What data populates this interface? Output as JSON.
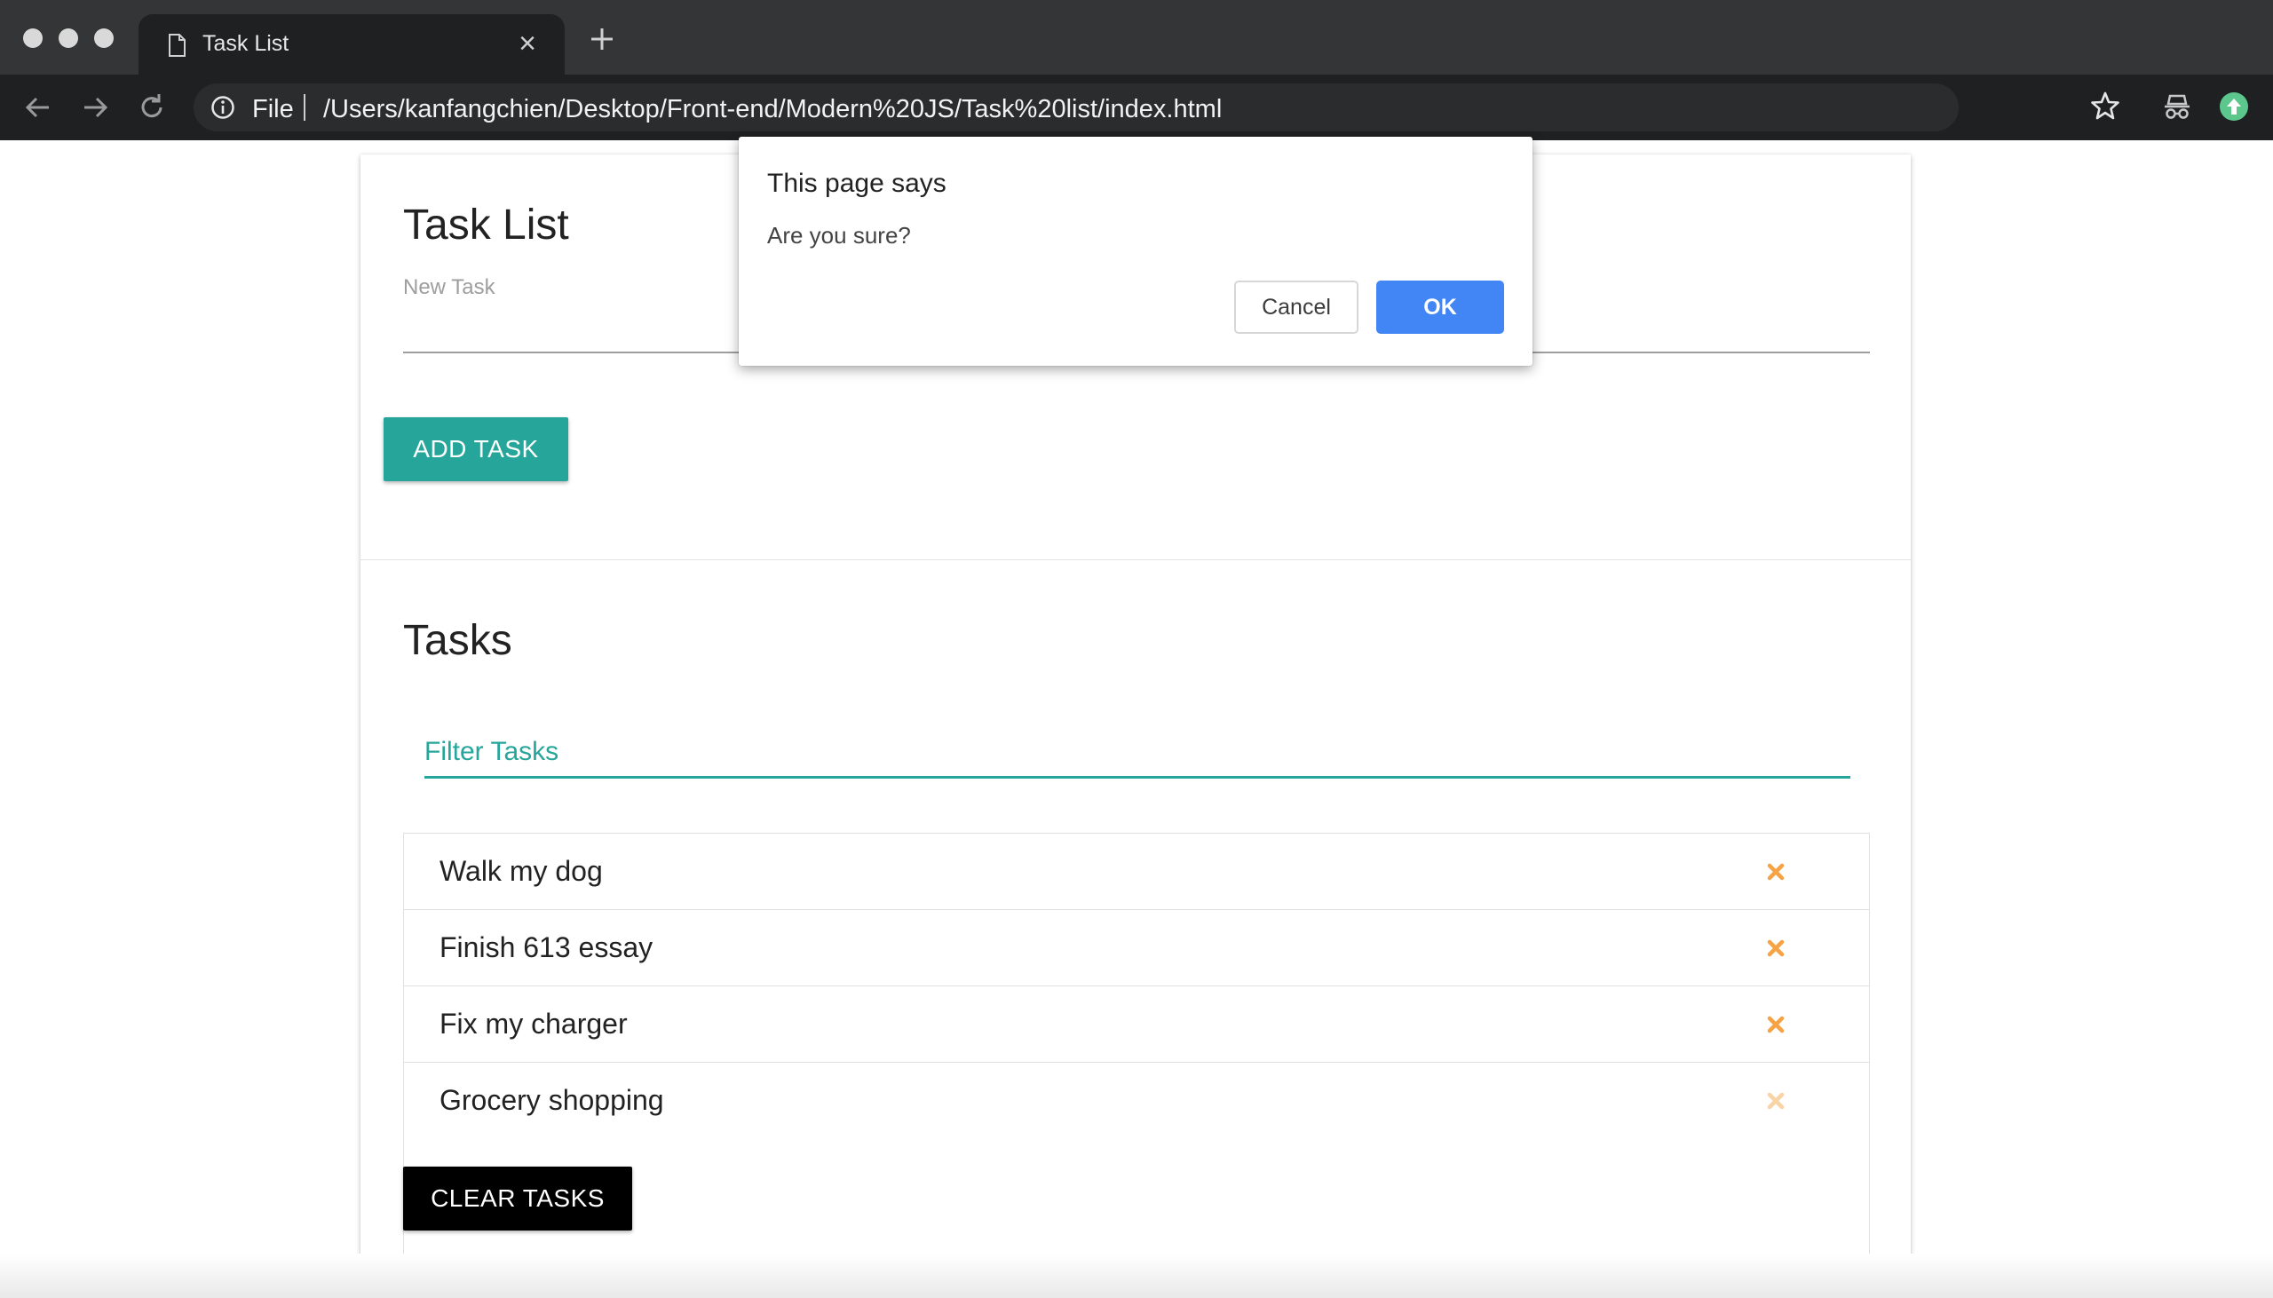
{
  "browser": {
    "tab_title": "Task List",
    "scheme_label": "File",
    "url": "/Users/kanfangchien/Desktop/Front-end/Modern%20JS/Task%20list/index.html",
    "close_glyph": "×"
  },
  "page": {
    "title": "Task List",
    "new_task_label": "New Task",
    "new_task_value": "",
    "add_button": "ADD TASK",
    "tasks_title": "Tasks",
    "filter_placeholder": "Filter Tasks",
    "tasks": [
      {
        "text": "Walk my dog"
      },
      {
        "text": "Finish 613 essay"
      },
      {
        "text": "Fix my charger"
      },
      {
        "text": "Grocery shopping"
      }
    ],
    "clear_button": "CLEAR TASKS",
    "accent_color": "#26a69a",
    "delete_icon_color": "#f6a345"
  },
  "dialog": {
    "title": "This page says",
    "message": "Are you sure?",
    "cancel_label": "Cancel",
    "ok_label": "OK",
    "ok_color": "#4285f4"
  }
}
